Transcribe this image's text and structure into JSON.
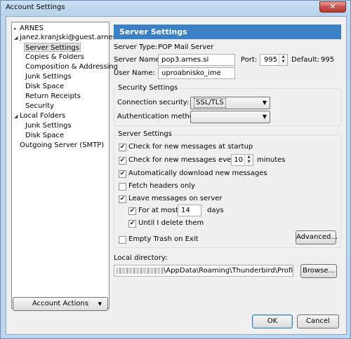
{
  "window": {
    "title": "Account Settings",
    "close_glyph": "✕"
  },
  "tree": {
    "items": [
      {
        "label": "ARNES",
        "twisty": "▸"
      },
      {
        "label": "janez.kranjski@guest.arnes.si",
        "twisty": "◢"
      },
      {
        "label": "Server Settings",
        "selected": true
      },
      {
        "label": "Copies & Folders"
      },
      {
        "label": "Composition & Addressing"
      },
      {
        "label": "Junk Settings"
      },
      {
        "label": "Disk Space"
      },
      {
        "label": "Return Receipts"
      },
      {
        "label": "Security"
      },
      {
        "label": "Local Folders",
        "twisty": "◢"
      },
      {
        "label": "Junk Settings"
      },
      {
        "label": "Disk Space"
      },
      {
        "label": "Outgoing Server (SMTP)"
      }
    ],
    "account_actions": {
      "label": "Account Actions",
      "arrow": "▼"
    }
  },
  "main": {
    "header": "Server Settings",
    "server_type_label": "Server Type:",
    "server_type_value": "POP Mail Server",
    "server_name_label": "Server Name:",
    "server_name_value": "pop3.arnes.si",
    "port_label": "Port:",
    "port_value": "995",
    "default_label": "Default:",
    "default_value": "995",
    "user_name_label": "User Name:",
    "user_name_value": "uproabnisko_ime",
    "security": {
      "title": "Security Settings",
      "connection_label": "Connection security:",
      "connection_value": "SSL/TLS",
      "auth_label": "Authentication method:",
      "auth_value": ""
    },
    "server_settings": {
      "title": "Server Settings",
      "check_startup": {
        "label": "Check for new messages at startup",
        "checked": true
      },
      "check_every": {
        "label": "Check for new messages every",
        "checked": true,
        "value": "10",
        "unit": "minutes"
      },
      "auto_download": {
        "label": "Automatically download new messages",
        "checked": true
      },
      "fetch_headers": {
        "label": "Fetch headers only",
        "checked": false
      },
      "leave_messages": {
        "label": "Leave messages on server",
        "checked": true
      },
      "for_at_most": {
        "label": "For at most",
        "checked": true,
        "value": "14",
        "unit": "days"
      },
      "until_delete": {
        "label": "Until I delete them",
        "checked": true
      },
      "empty_trash": {
        "label": "Empty Trash on Exit",
        "checked": false
      },
      "advanced_label": "Advanced..."
    },
    "local_directory": {
      "label": "Local directory:",
      "path_suffix": "\\AppData\\Roaming\\Thunderbird\\Profiles",
      "browse_label": "Browse..."
    }
  },
  "footer": {
    "ok_label": "OK",
    "cancel_label": "Cancel"
  },
  "glyphs": {
    "check": "✔",
    "dropdown": "▼",
    "spin_up": "▲",
    "spin_down": "▼"
  }
}
